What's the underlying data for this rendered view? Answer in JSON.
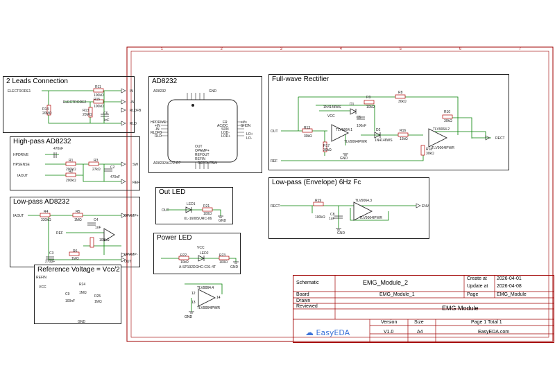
{
  "sheet": {
    "border_color": "#a00000",
    "wire_color": "#008000",
    "net_color": "#1a1ad6",
    "designator_color": "#b00000",
    "col_numbers": [
      "1",
      "2",
      "3",
      "4",
      "5",
      "6",
      "7"
    ]
  },
  "blocks": {
    "two_leads": {
      "title": "2 Leads Connection",
      "labels": [
        "ELECTRODE1",
        "ELECTRODE2",
        "R11",
        "100kΩ",
        "R15",
        "100kΩ",
        "R14",
        "20MΩ",
        "R13",
        "20MΩ",
        "C6",
        "1nF",
        "IN",
        "-IN",
        "RLDFB",
        "RLD"
      ]
    },
    "ad8232": {
      "title": "AD8232",
      "labels": [
        "AD8232",
        "HPDRIVE",
        "+IN",
        "-IN",
        "RLDFB",
        "RLD",
        "AD8232ACPZ-R7",
        "FR",
        "AC/DC",
        "SDN",
        "LOD-",
        "LOD+",
        "OUT",
        "OPAMP+",
        "REFOUT",
        "REFIN",
        "GND",
        "LO+",
        "LO-",
        "+Vs",
        "REFOUT",
        "SW",
        "SHDN"
      ]
    },
    "highpass": {
      "title": "High-pass AD8232",
      "labels": [
        "HPDRIVE",
        "HPSENSE",
        "IAOUT",
        "470nF",
        "R1",
        "200kΩ",
        "R2",
        "200kΩ",
        "R3",
        "27kΩ",
        "C2",
        "470nF",
        "SW",
        "REF"
      ]
    },
    "lowpass": {
      "title": "Low-pass AD8232",
      "labels": [
        "IAOUT",
        "R4",
        "330kΩ",
        "R5",
        "1MΩ",
        "C4",
        "1nF",
        "REF",
        "100kΩ",
        "C3",
        "270pF",
        "R6",
        "1MΩ",
        "OPAMP+",
        "OPAMP-",
        "OUT"
      ]
    },
    "refvolt": {
      "title": "Reference Voltage = Vcc/2",
      "labels": [
        "REFIN",
        "VCC",
        "R24",
        "1MΩ",
        "C9",
        "100nF",
        "R25",
        "1MΩ",
        "GND"
      ]
    },
    "outled": {
      "title": "Out LED",
      "labels": [
        "OUT",
        "LED1",
        "XL-1608SURC-06",
        "R21",
        "100Ω",
        "GND"
      ]
    },
    "powerled": {
      "title": "Power LED",
      "labels": [
        "VCC",
        "R22",
        "10kΩ",
        "LED2",
        "A-SP192DGHC-C01-4T",
        "R23",
        "100Ω",
        "GND"
      ]
    },
    "spare_opamp": {
      "labels": [
        "TLV9064.4",
        "TLV9064IPWR",
        "GND",
        "12",
        "13",
        "14"
      ]
    },
    "rectifier": {
      "title": "Full-wave Rectifier",
      "labels": [
        "R9",
        "10kΩ",
        "R8",
        "30kΩ",
        "1N4148WS",
        "D1",
        "VCC",
        "C5",
        "100nF",
        "R13",
        "30kΩ",
        "TLV9064.1",
        "TLV9064IPWR",
        "D2",
        "1N4148WS",
        "R16",
        "15kΩ",
        "R17",
        "30kΩ",
        "GND",
        "R18",
        "30kΩ",
        "R10",
        "30kΩ",
        "TLV9064.2",
        "TLV9064IPWR",
        "OUT",
        "REF",
        "RECT"
      ]
    },
    "envelope": {
      "title": "Low-pass (Envelope) 6Hz Fc",
      "labels": [
        "RECT",
        "R19",
        "100kΩ",
        "C8",
        "1uF",
        "GND",
        "TLV9064.3",
        "TLV9064IPWR",
        "ENV"
      ]
    }
  },
  "title_block": {
    "schematic_label": "Schematic",
    "schematic_value": "EMG_Module_2",
    "board_label": "Board",
    "board_value": "EMG_Module_1",
    "create_label": "Create at",
    "create_value": "2026-04-01",
    "update_label": "Update at",
    "update_value": "2026-04-08",
    "page_label": "Page",
    "page_value": "EMG_Module",
    "drawn_label": "Drawn",
    "reviewed_label": "Reviewed",
    "project_value": "EMG Module",
    "version_label": "Version",
    "version_value": "V1.0",
    "size_label": "Size",
    "size_value": "A4",
    "page_count_value": "Page  1  Total  1",
    "site_value": "EasyEDA.com",
    "brand": "EasyEDA"
  }
}
